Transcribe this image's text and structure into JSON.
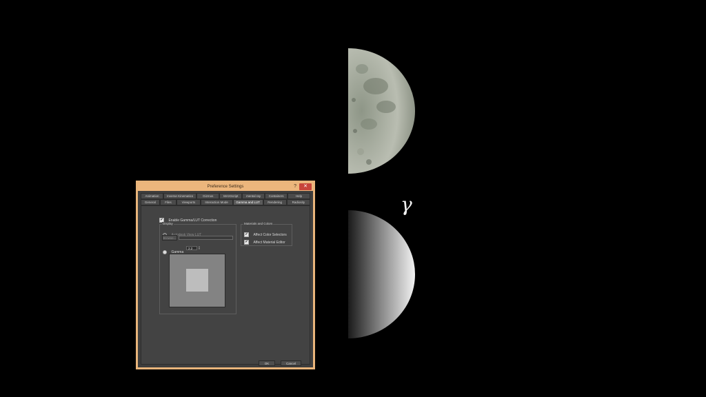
{
  "dialog": {
    "title": "Preference Settings",
    "help_glyph": "?",
    "close_glyph": "✕",
    "tabs_row1": [
      "Animation",
      "Inverse Kinematics",
      "Gizmos",
      "MAXScript",
      "mental ray",
      "Containers",
      "Help"
    ],
    "tabs_row2": [
      "General",
      "Files",
      "Viewports",
      "Interaction Mode",
      "Gamma and LUT",
      "Rendering",
      "Radiosity"
    ],
    "active_tab": "Gamma and LUT",
    "enable_correction": {
      "label": "Enable Gamma/LUT Correction",
      "checked": true
    },
    "display": {
      "legend": "Display",
      "lut_option": "Autodesk View LUT",
      "browse_label": "Browse...",
      "gamma_option": "Gamma",
      "gamma_value": "2.2"
    },
    "materials": {
      "legend": "Materials and Colors",
      "affect_color_selectors": {
        "label": "Affect Color Selectors",
        "checked": true
      },
      "affect_material_editor": {
        "label": "Affect Material Editor",
        "checked": true
      }
    },
    "ok_label": "OK",
    "cancel_label": "Cancel"
  },
  "decor": {
    "gamma_symbol": "γ",
    "checkmark": "✔"
  }
}
